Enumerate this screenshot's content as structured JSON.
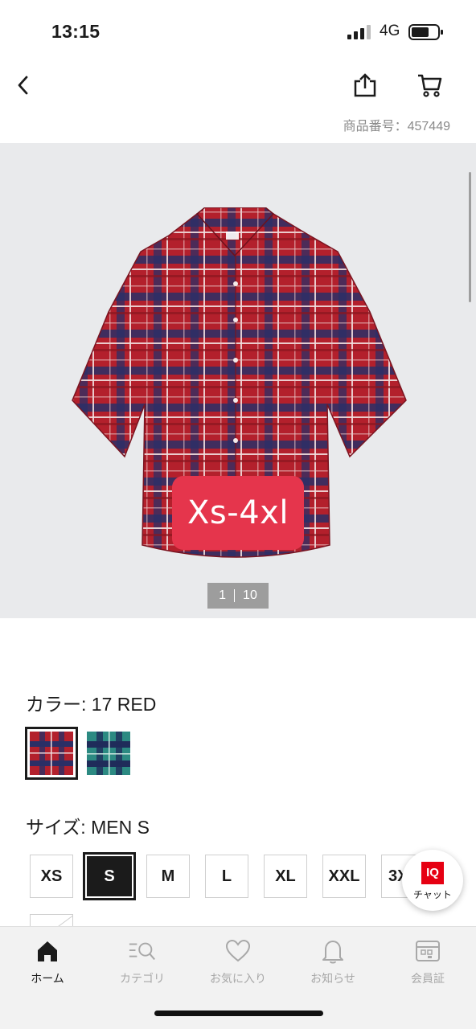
{
  "status_bar": {
    "time": "13:15",
    "network": "4G"
  },
  "header": {
    "product_code_label": "商品番号：",
    "product_code_value": "457449"
  },
  "gallery": {
    "badge_text": "Xs-4xl",
    "current_page": "1",
    "total_pages": "10"
  },
  "color": {
    "label": "カラー: 17 RED",
    "swatches": [
      "red-check",
      "green-check"
    ],
    "selected": "red-check"
  },
  "size": {
    "label": "サイズ: MEN S",
    "options": [
      "XS",
      "S",
      "M",
      "L",
      "XL",
      "XXL",
      "3X"
    ],
    "selected": "S"
  },
  "chat": {
    "badge": "IQ",
    "label": "チャット"
  },
  "nav": {
    "items": [
      {
        "label": "ホーム",
        "icon": "home-icon",
        "active": true
      },
      {
        "label": "カテゴリ",
        "icon": "category-search-icon",
        "active": false
      },
      {
        "label": "お気に入り",
        "icon": "heart-icon",
        "active": false
      },
      {
        "label": "お知らせ",
        "icon": "bell-icon",
        "active": false
      },
      {
        "label": "会員証",
        "icon": "membership-card-icon",
        "active": false
      }
    ]
  },
  "colors": {
    "accent_red": "#e60012",
    "badge_red": "#e5354c",
    "text": "#1b1b1b",
    "muted": "#a8a8a8"
  }
}
